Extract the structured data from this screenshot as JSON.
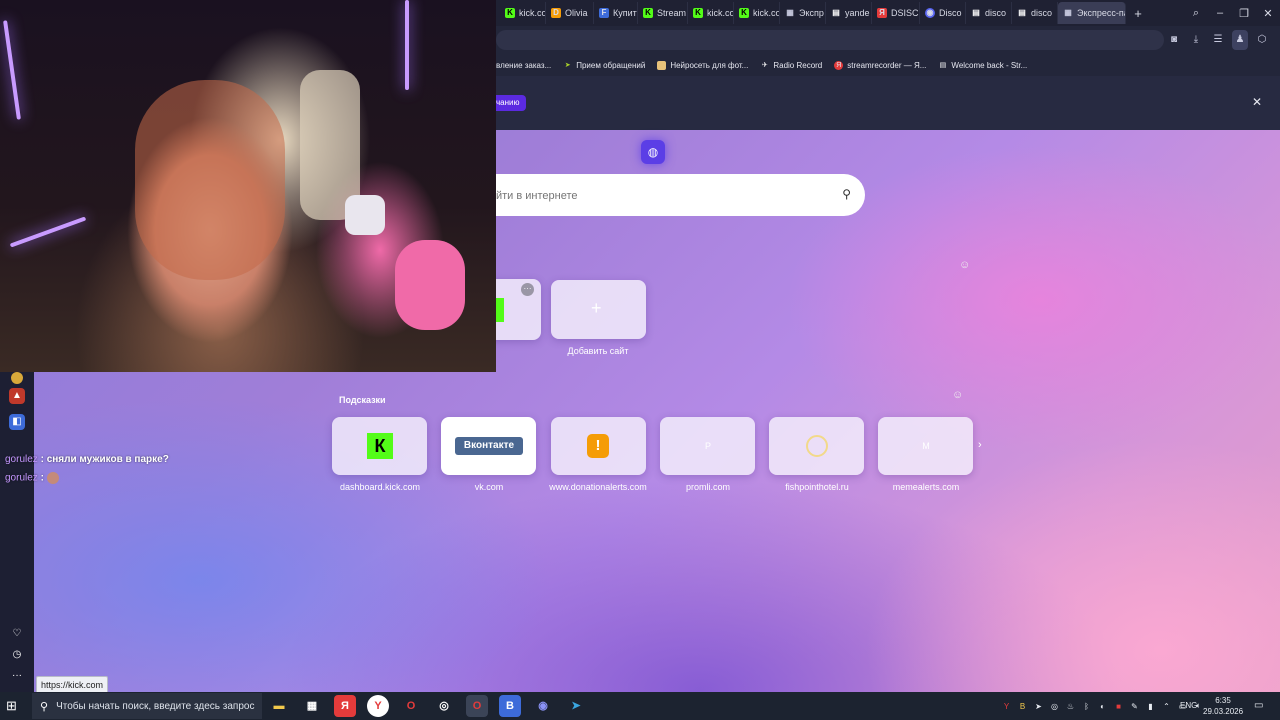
{
  "tabs": [
    {
      "label": "kick.co",
      "icon": "kick-icon",
      "color": "#53fc18"
    },
    {
      "label": "Olivia",
      "icon": "donationalerts-icon",
      "color": "#f59c07"
    },
    {
      "label": "Купит",
      "icon": "f-icon",
      "color": "#3d6bd9"
    },
    {
      "label": "Stream",
      "icon": "kick-icon",
      "color": "#53fc18"
    },
    {
      "label": "kick.co",
      "icon": "kick-icon",
      "color": "#53fc18"
    },
    {
      "label": "kick.co",
      "icon": "kick-icon",
      "color": "#53fc18"
    },
    {
      "label": "Экспр",
      "icon": "grid-icon",
      "color": "#c9cbe0"
    },
    {
      "label": "yande",
      "icon": "doc-icon",
      "color": "#ffffff"
    },
    {
      "label": "DSISC",
      "icon": "yandex-icon",
      "color": "#e43b3b"
    },
    {
      "label": "Disco",
      "icon": "discord-icon",
      "color": "#5865f2"
    },
    {
      "label": "disco",
      "icon": "doc-icon",
      "color": "#ffffff"
    },
    {
      "label": "disco",
      "icon": "doc-icon",
      "color": "#ffffff"
    },
    {
      "label": "Экспресс-па",
      "icon": "grid-icon",
      "color": "#c9cbe0",
      "active": true
    }
  ],
  "bookmarks": [
    {
      "label": "вление заказ...",
      "color": "#c9cbe0"
    },
    {
      "label": "Прием обращений",
      "color": "#a8d12a"
    },
    {
      "label": "Нейросеть для фот...",
      "color": "#e8c27a"
    },
    {
      "label": "Radio Record",
      "color": "#ffffff"
    },
    {
      "label": "streamrecorder — Я...",
      "color": "#e43b3b"
    },
    {
      "label": "Welcome back - Str...",
      "color": "#ffffff"
    }
  ],
  "notice": {
    "button_label": "чанию"
  },
  "search": {
    "placeholder": "йти в интернете"
  },
  "speed_dial": {
    "add_label": "Добавить сайт"
  },
  "suggestions": {
    "title": "Подсказки",
    "items": [
      {
        "label": "dashboard.kick.com",
        "logo": "К"
      },
      {
        "label": "vk.com",
        "logo": "Вконтакте"
      },
      {
        "label": "www.donationalerts.com",
        "logo": "!"
      },
      {
        "label": "promli.com",
        "logo": "P"
      },
      {
        "label": "fishpointhotel.ru",
        "logo": ""
      },
      {
        "label": "memealerts.com",
        "logo": "M"
      }
    ]
  },
  "chat": [
    {
      "user": "gorulez",
      "message": ": сняли мужиков в парке?"
    },
    {
      "user": "gorulez",
      "message": ":"
    }
  ],
  "status_url": "https://kick.com",
  "taskbar": {
    "search_placeholder": "Чтобы начать поиск, введите здесь запрос",
    "lang": "ENG",
    "time": "6:35",
    "date": "29.03.2026"
  },
  "colors": {
    "accent": "#5b3ee6",
    "kick_green": "#53fc18",
    "vk_blue": "#4a6791",
    "donationalerts_orange": "#f59c07",
    "chat_username": "#c597ff"
  }
}
